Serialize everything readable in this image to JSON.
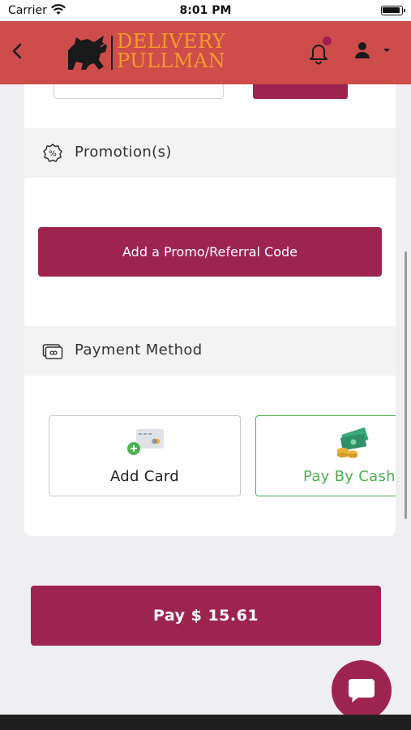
{
  "status_bar": {
    "carrier": "Carrier",
    "time": "8:01 PM"
  },
  "header": {
    "logo_line1": "DELIVERY",
    "logo_line2": "PULLMAN",
    "brand_color": "#cd4d4a",
    "logo_text_color": "#f59a2a",
    "notification_dot_color": "#9e1c4f",
    "icons": [
      "back-chevron-icon",
      "bell-icon",
      "user-icon",
      "caret-down-icon"
    ]
  },
  "promotion": {
    "title": "Promotion(s)",
    "icon": "percent-badge-icon",
    "button_label": "Add a Promo/Referral Code"
  },
  "payment": {
    "title": "Payment Method",
    "icon": "payment-card-icon",
    "options": [
      {
        "label": "Add Card",
        "icon": "add-card-icon",
        "selected": false
      },
      {
        "label": "Pay By Cash",
        "icon": "cash-icon",
        "selected": true
      }
    ]
  },
  "pay_button": {
    "label": "Pay $ 15.61"
  },
  "chat": {
    "icon": "chat-bubble-icon"
  },
  "colors": {
    "accent": "#9e2450",
    "selected_border": "#4caf50",
    "page_bg": "#efeff1"
  }
}
